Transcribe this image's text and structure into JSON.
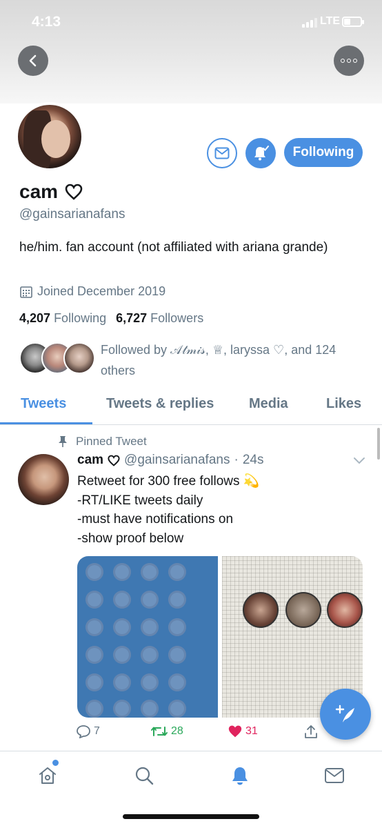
{
  "status_bar": {
    "time": "4:13",
    "network": "LTE"
  },
  "header": {
    "back_icon": "chevron-left-icon",
    "more_icon": "more-dots-icon"
  },
  "profile": {
    "name": "cam",
    "handle": "@gainsarianafans",
    "bio": "he/him. fan account (not affiliated with ariana grande)",
    "joined": "Joined December 2019",
    "following_count": "4,207",
    "following_label": "Following",
    "followers_count": "6,727",
    "followers_label": "Followers",
    "followed_by": "Followed by 𝒜𝓉𝓂𝒾𝓈, ♕, laryssa ♡, and 124 others",
    "follow_button": "Following"
  },
  "tabs": [
    {
      "label": "Tweets",
      "active": true
    },
    {
      "label": "Tweets & replies",
      "active": false
    },
    {
      "label": "Media",
      "active": false
    },
    {
      "label": "Likes",
      "active": false
    }
  ],
  "tweet": {
    "pinned_label": "Pinned Tweet",
    "name": "cam",
    "handle": "@gainsarianafans",
    "time": "24s",
    "text": "Retweet for 300 free follows 💫\n-RT/LIKE tweets daily\n-must have notifications on\n-show proof below",
    "replies": "7",
    "retweets": "28",
    "likes": "31"
  },
  "colors": {
    "accent": "#4a90e2",
    "retweet": "#2aa85a",
    "like": "#e0245e",
    "muted": "#657786"
  },
  "bottom_nav": [
    "home-icon",
    "search-icon",
    "notifications-bell-icon",
    "messages-envelope-icon"
  ]
}
